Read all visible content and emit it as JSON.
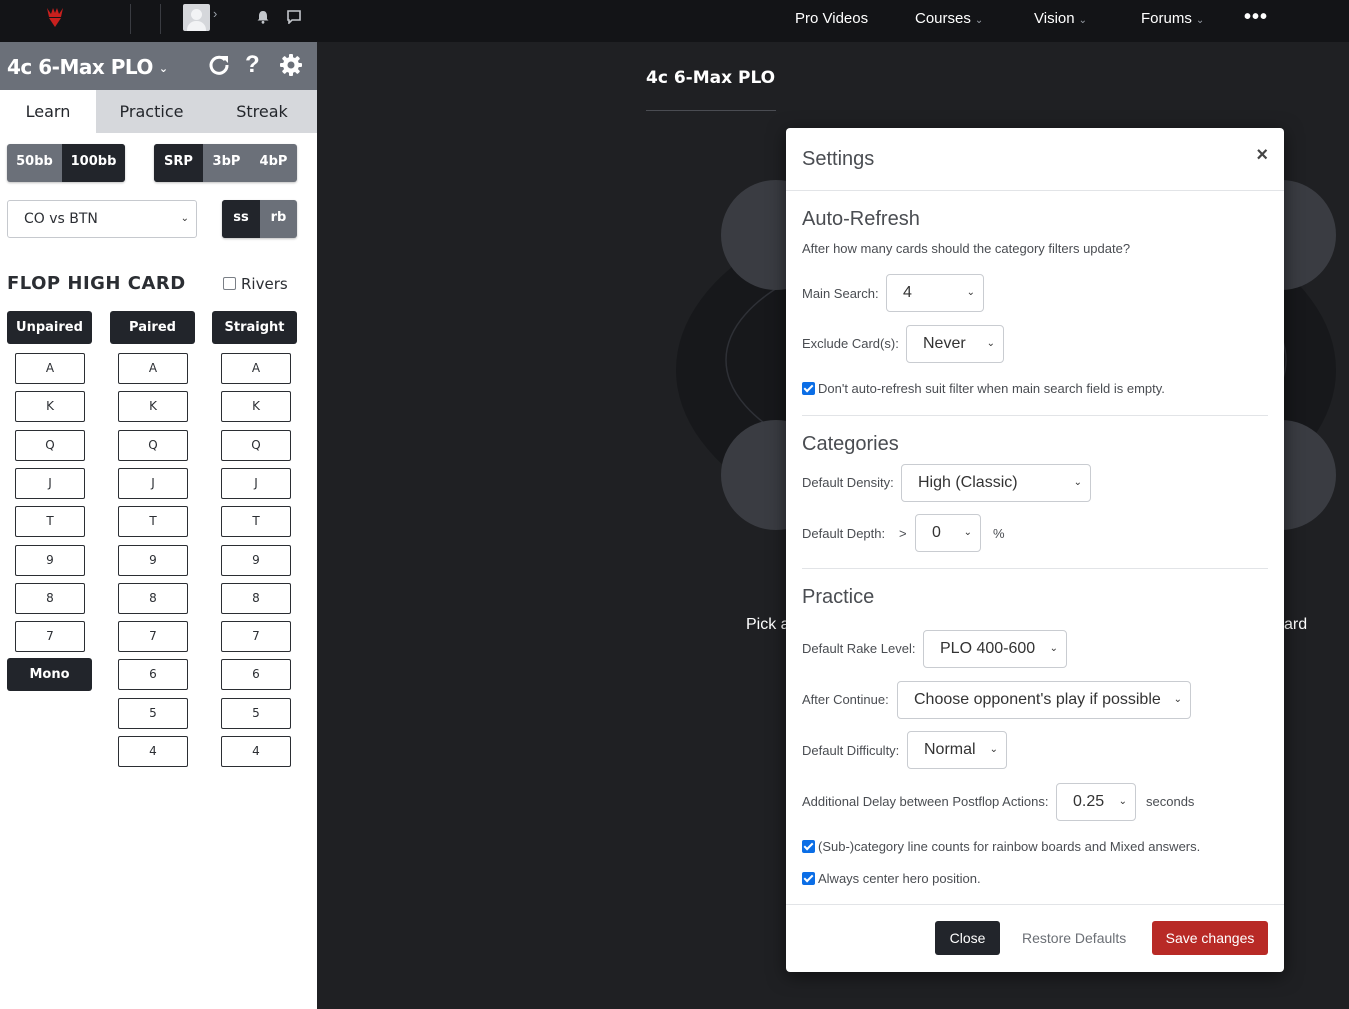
{
  "nav": {
    "items": [
      {
        "label": "Pro Videos",
        "dropdown": false
      },
      {
        "label": "Courses",
        "dropdown": true
      },
      {
        "label": "Vision",
        "dropdown": true
      },
      {
        "label": "Forums",
        "dropdown": true
      }
    ],
    "more_label": "•••",
    "brand_color": "#c8201e"
  },
  "sidebar": {
    "title": "4c 6-Max PLO",
    "tabs": [
      "Learn",
      "Practice",
      "Streak"
    ],
    "active_tab": "Learn",
    "stacks": [
      "50bb",
      "100bb"
    ],
    "active_stack": "100bb",
    "pots": [
      "SRP",
      "3bP",
      "4bP"
    ],
    "active_pot": "SRP",
    "matchup": "CO vs BTN",
    "modes": [
      "ss",
      "rb"
    ],
    "active_mode": "ss",
    "section_title": "FLOP HIGH CARD",
    "rivers_label": "Rivers",
    "columns": [
      {
        "header": "Unpaired",
        "cards": [
          "A",
          "K",
          "Q",
          "J",
          "T",
          "9",
          "8",
          "7"
        ],
        "extra": "Mono"
      },
      {
        "header": "Paired",
        "cards": [
          "A",
          "K",
          "Q",
          "J",
          "T",
          "9",
          "8",
          "7",
          "6",
          "5",
          "4"
        ]
      },
      {
        "header": "Straight",
        "cards": [
          "A",
          "K",
          "Q",
          "J",
          "T",
          "9",
          "8",
          "7",
          "6",
          "5",
          "4"
        ]
      }
    ]
  },
  "main": {
    "title": "4c 6-Max PLO",
    "pick_left": "Pick a",
    "pick_right": "ard"
  },
  "settings": {
    "title": "Settings",
    "close_glyph": "×",
    "auto_refresh": {
      "heading": "Auto-Refresh",
      "description": "After how many cards should the category filters update?",
      "main_search_label": "Main Search:",
      "main_search_value": "4",
      "exclude_label": "Exclude Card(s):",
      "exclude_value": "Never",
      "suit_filter_label": "Don't auto-refresh suit filter when main search field is empty.",
      "suit_filter_checked": true
    },
    "categories": {
      "heading": "Categories",
      "density_label": "Default Density:",
      "density_value": "High (Classic)",
      "depth_label": "Default Depth:",
      "depth_prefix": ">",
      "depth_value": "0",
      "depth_suffix": "%"
    },
    "practice": {
      "heading": "Practice",
      "rake_label": "Default Rake Level:",
      "rake_value": "PLO 400-600",
      "continue_label": "After Continue:",
      "continue_value": "Choose opponent's play if possible",
      "difficulty_label": "Default Difficulty:",
      "difficulty_value": "Normal",
      "delay_label": "Additional Delay between Postflop Actions:",
      "delay_value": "0.25",
      "delay_suffix": "seconds",
      "line_counts_label": "(Sub-)category line counts for rainbow boards and Mixed answers.",
      "line_counts_checked": true,
      "center_hero_label": "Always center hero position.",
      "center_hero_checked": true
    },
    "buttons": {
      "close": "Close",
      "restore": "Restore Defaults",
      "save": "Save changes"
    }
  }
}
